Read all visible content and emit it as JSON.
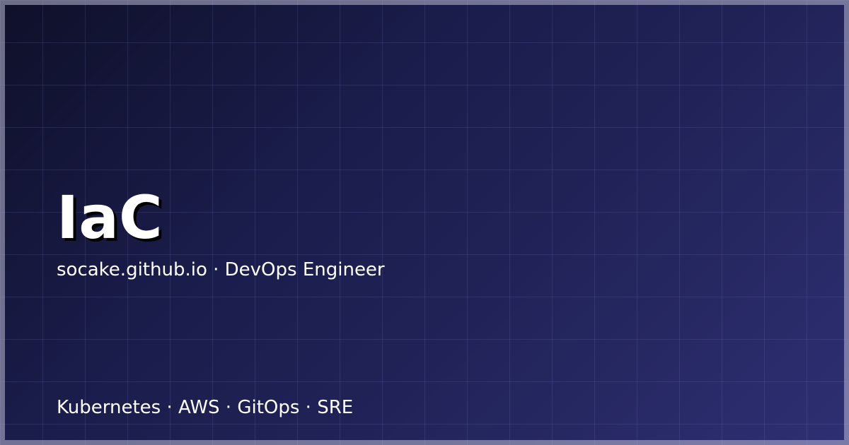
{
  "card": {
    "title": "IaC",
    "subtitle": "socake.github.io · DevOps Engineer",
    "tags": "Kubernetes · AWS · GitOps · SRE"
  },
  "colors": {
    "background_start": "#0f1029",
    "background_end": "#2e2f73",
    "text": "#ffffff",
    "title_shadow": "#000000",
    "frame": "#b9b9d2"
  }
}
